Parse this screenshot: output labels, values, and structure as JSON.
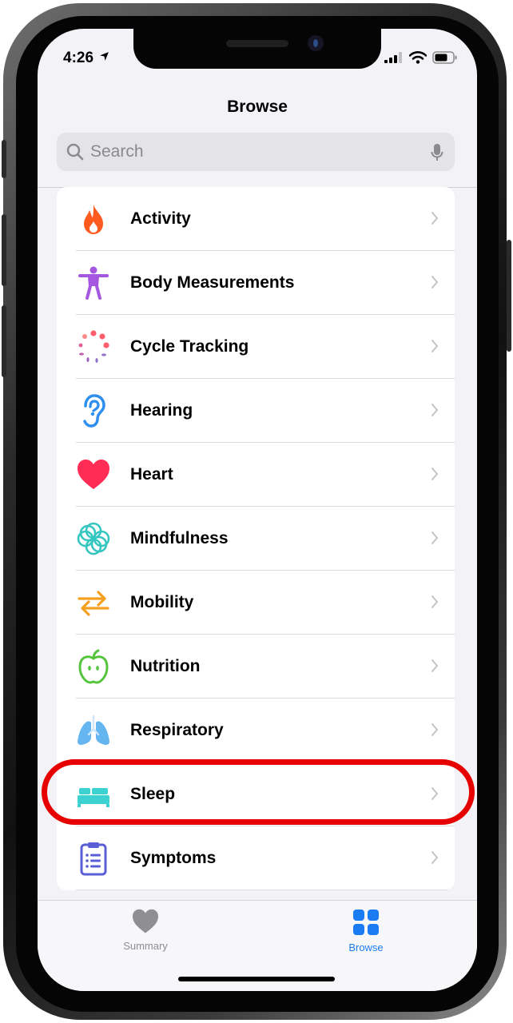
{
  "status_bar": {
    "time": "4:26"
  },
  "nav": {
    "title": "Browse"
  },
  "search": {
    "placeholder": "Search"
  },
  "categories": [
    {
      "label": "Activity",
      "icon": "flame-icon"
    },
    {
      "label": "Body Measurements",
      "icon": "person-figure-icon"
    },
    {
      "label": "Cycle Tracking",
      "icon": "cycle-dots-icon"
    },
    {
      "label": "Hearing",
      "icon": "ear-icon"
    },
    {
      "label": "Heart",
      "icon": "heart-icon"
    },
    {
      "label": "Mindfulness",
      "icon": "flower-icon"
    },
    {
      "label": "Mobility",
      "icon": "arrows-icon"
    },
    {
      "label": "Nutrition",
      "icon": "apple-icon"
    },
    {
      "label": "Respiratory",
      "icon": "lungs-icon"
    },
    {
      "label": "Sleep",
      "icon": "bed-icon"
    },
    {
      "label": "Symptoms",
      "icon": "clipboard-icon"
    }
  ],
  "tabs": [
    {
      "label": "Summary",
      "active": false
    },
    {
      "label": "Browse",
      "active": true
    }
  ],
  "colors": {
    "accent": "#1a7cf2",
    "inactive_tab": "#8e8e93",
    "highlight": "#e60000",
    "activity": "#ff5a1f",
    "body": "#a557e0",
    "hearing": "#2f8ff0",
    "heart": "#ff2d55",
    "mindfulness": "#35c6c0",
    "mobility": "#f5a020",
    "nutrition": "#55c43c",
    "respiratory": "#64b5f0",
    "sleep": "#3dd1d1",
    "symptoms": "#5b5fd6"
  }
}
